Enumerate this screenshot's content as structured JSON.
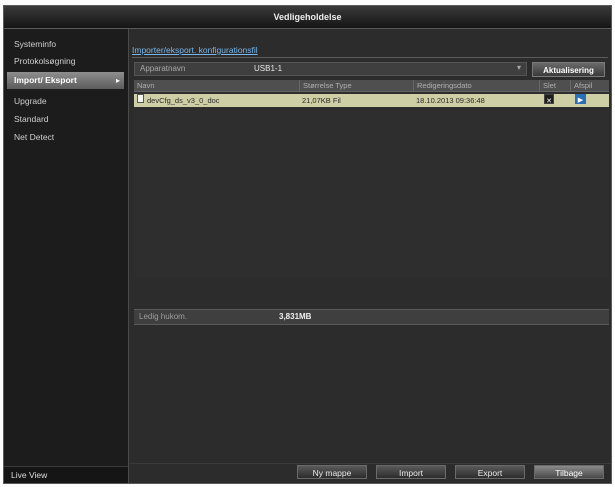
{
  "window": {
    "title": "Vedligeholdelse"
  },
  "sidebar": {
    "items": [
      {
        "label": "Systeminfo"
      },
      {
        "label": "Protokolsøgning"
      },
      {
        "label": "Import/ Eksport"
      },
      {
        "label": "Upgrade"
      },
      {
        "label": "Standard"
      },
      {
        "label": "Net Detect"
      }
    ],
    "selected": "Import/ Eksport",
    "live_view": "Live View"
  },
  "breadcrumb": {
    "tab": "Importer/eksport. konfigurationsfil"
  },
  "device": {
    "label": "Apparatnavn",
    "value": "USB1-1"
  },
  "refresh_button": "Aktualisering",
  "table": {
    "headers": {
      "name": "Navn",
      "size": "Størrelse Type",
      "date": "Redigeringsdato",
      "delete": "Slet",
      "play": "Afspil"
    },
    "rows": [
      {
        "name": "devCfg_ds_v3_0_doc",
        "size": "21,07KB Fil",
        "date": "18.10.2013 09:36:48"
      }
    ]
  },
  "free_space": {
    "label": "Ledig hukom.",
    "value": "3,831MB"
  },
  "buttons": {
    "new_folder": "Ny mappe",
    "import": "Import",
    "export": "Export",
    "back": "Tilbage"
  },
  "colors": {
    "selected_row": "#cfcfa6",
    "link": "#79b6ea",
    "play_button": "#2970b8"
  }
}
